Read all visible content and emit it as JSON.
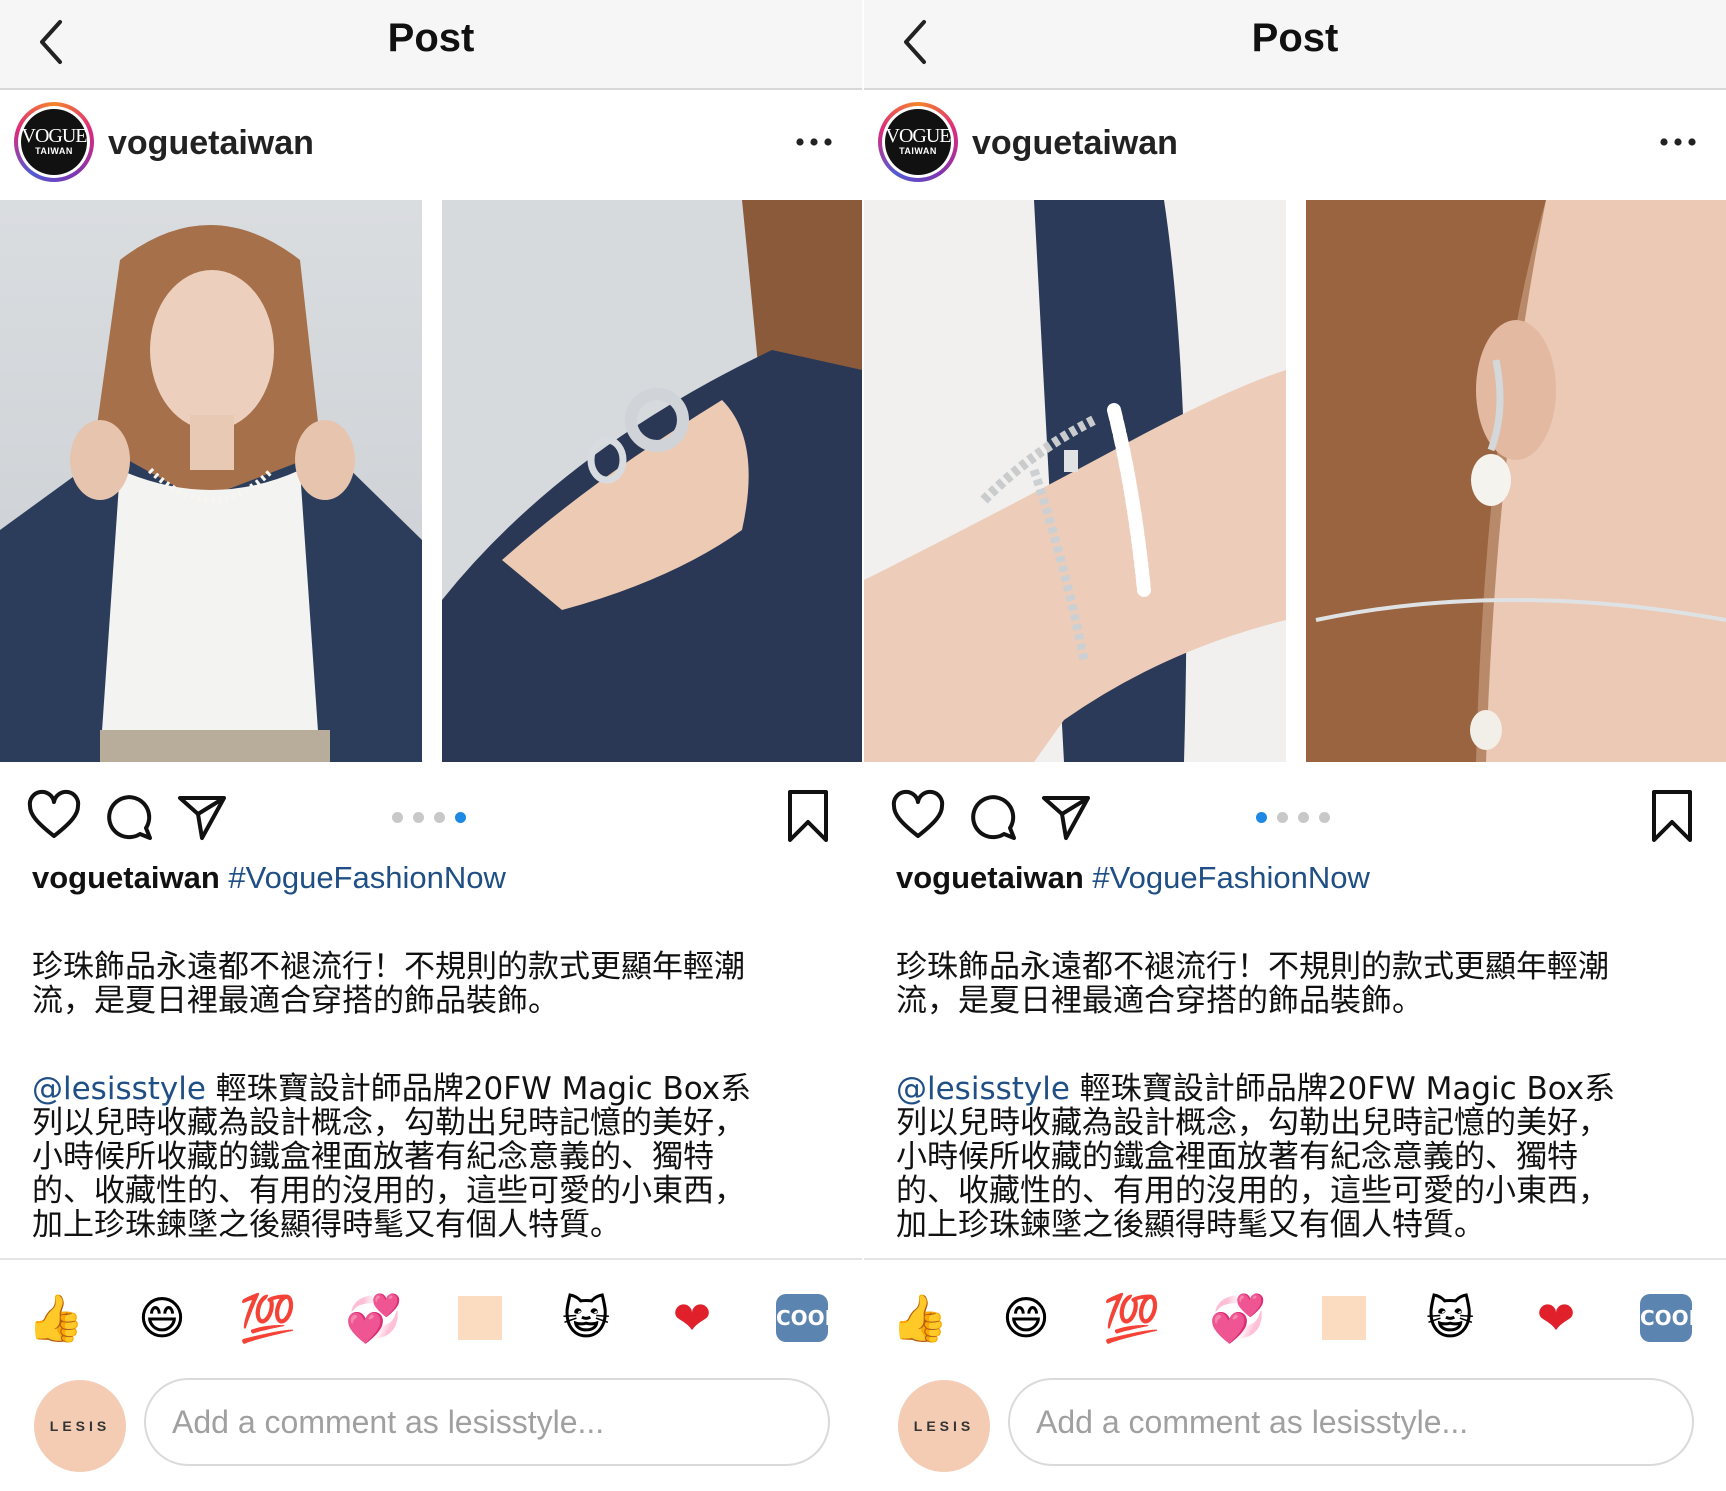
{
  "colors": {
    "accent_blue": "#1e88e5",
    "link_blue": "#1f4f85",
    "avatar_bg": "#f4ccb4"
  },
  "screens": [
    {
      "topbar": {
        "title": "Post",
        "back_icon": "chevron-left-icon"
      },
      "profile": {
        "username": "voguetaiwan",
        "logo_main": "VOGUE",
        "logo_sub": "TAIWAN",
        "more_icon": "more-horizontal-icon"
      },
      "photos": [
        "model-denim-jacket-photo",
        "hand-rings-photo"
      ],
      "carousel": {
        "count": 4,
        "active_index": 3
      },
      "caption": {
        "username": "voguetaiwan",
        "hashtag": "#VogueFashionNow",
        "paragraph1": "珍珠飾品永遠都不褪流行！不規則的款式更顯年輕潮\n流，是夏日裡最適合穿搭的飾品裝飾。",
        "mention": "@lesisstyle",
        "paragraph2": " 輕珠寶設計師品牌20FW Magic Box系\n列以兒時收藏為設計概念，勾勒出兒時記憶的美好，\n小時候所收藏的鐵盒裡面放著有紀念意義的、獨特\n的、收藏性的、有用的沒用的，這些可愛的小東西，\n加上珍珠鍊墜之後顯得時髦又有個人特質。"
      },
      "emojis": [
        "👍",
        "😄",
        "💯",
        "💞",
        "",
        "😺",
        "❤",
        "COOL"
      ],
      "comment": {
        "avatar_text": "LESIS",
        "placeholder": "Add a comment as lesisstyle..."
      }
    },
    {
      "topbar": {
        "title": "Post",
        "back_icon": "chevron-left-icon"
      },
      "profile": {
        "username": "voguetaiwan",
        "logo_main": "VOGUE",
        "logo_sub": "TAIWAN",
        "more_icon": "more-horizontal-icon"
      },
      "photos": [
        "wrist-bracelets-photo",
        "ear-pearl-earring-photo"
      ],
      "carousel": {
        "count": 4,
        "active_index": 0
      },
      "caption": {
        "username": "voguetaiwan",
        "hashtag": "#VogueFashionNow",
        "paragraph1": "珍珠飾品永遠都不褪流行！不規則的款式更顯年輕潮\n流，是夏日裡最適合穿搭的飾品裝飾。",
        "mention": "@lesisstyle",
        "paragraph2": " 輕珠寶設計師品牌20FW Magic Box系\n列以兒時收藏為設計概念，勾勒出兒時記憶的美好，\n小時候所收藏的鐵盒裡面放著有紀念意義的、獨特\n的、收藏性的、有用的沒用的，這些可愛的小東西，\n加上珍珠鍊墜之後顯得時髦又有個人特質。"
      },
      "emojis": [
        "👍",
        "😄",
        "💯",
        "💞",
        "",
        "😺",
        "❤",
        "COOL"
      ],
      "comment": {
        "avatar_text": "LESIS",
        "placeholder": "Add a comment as lesisstyle..."
      }
    }
  ]
}
